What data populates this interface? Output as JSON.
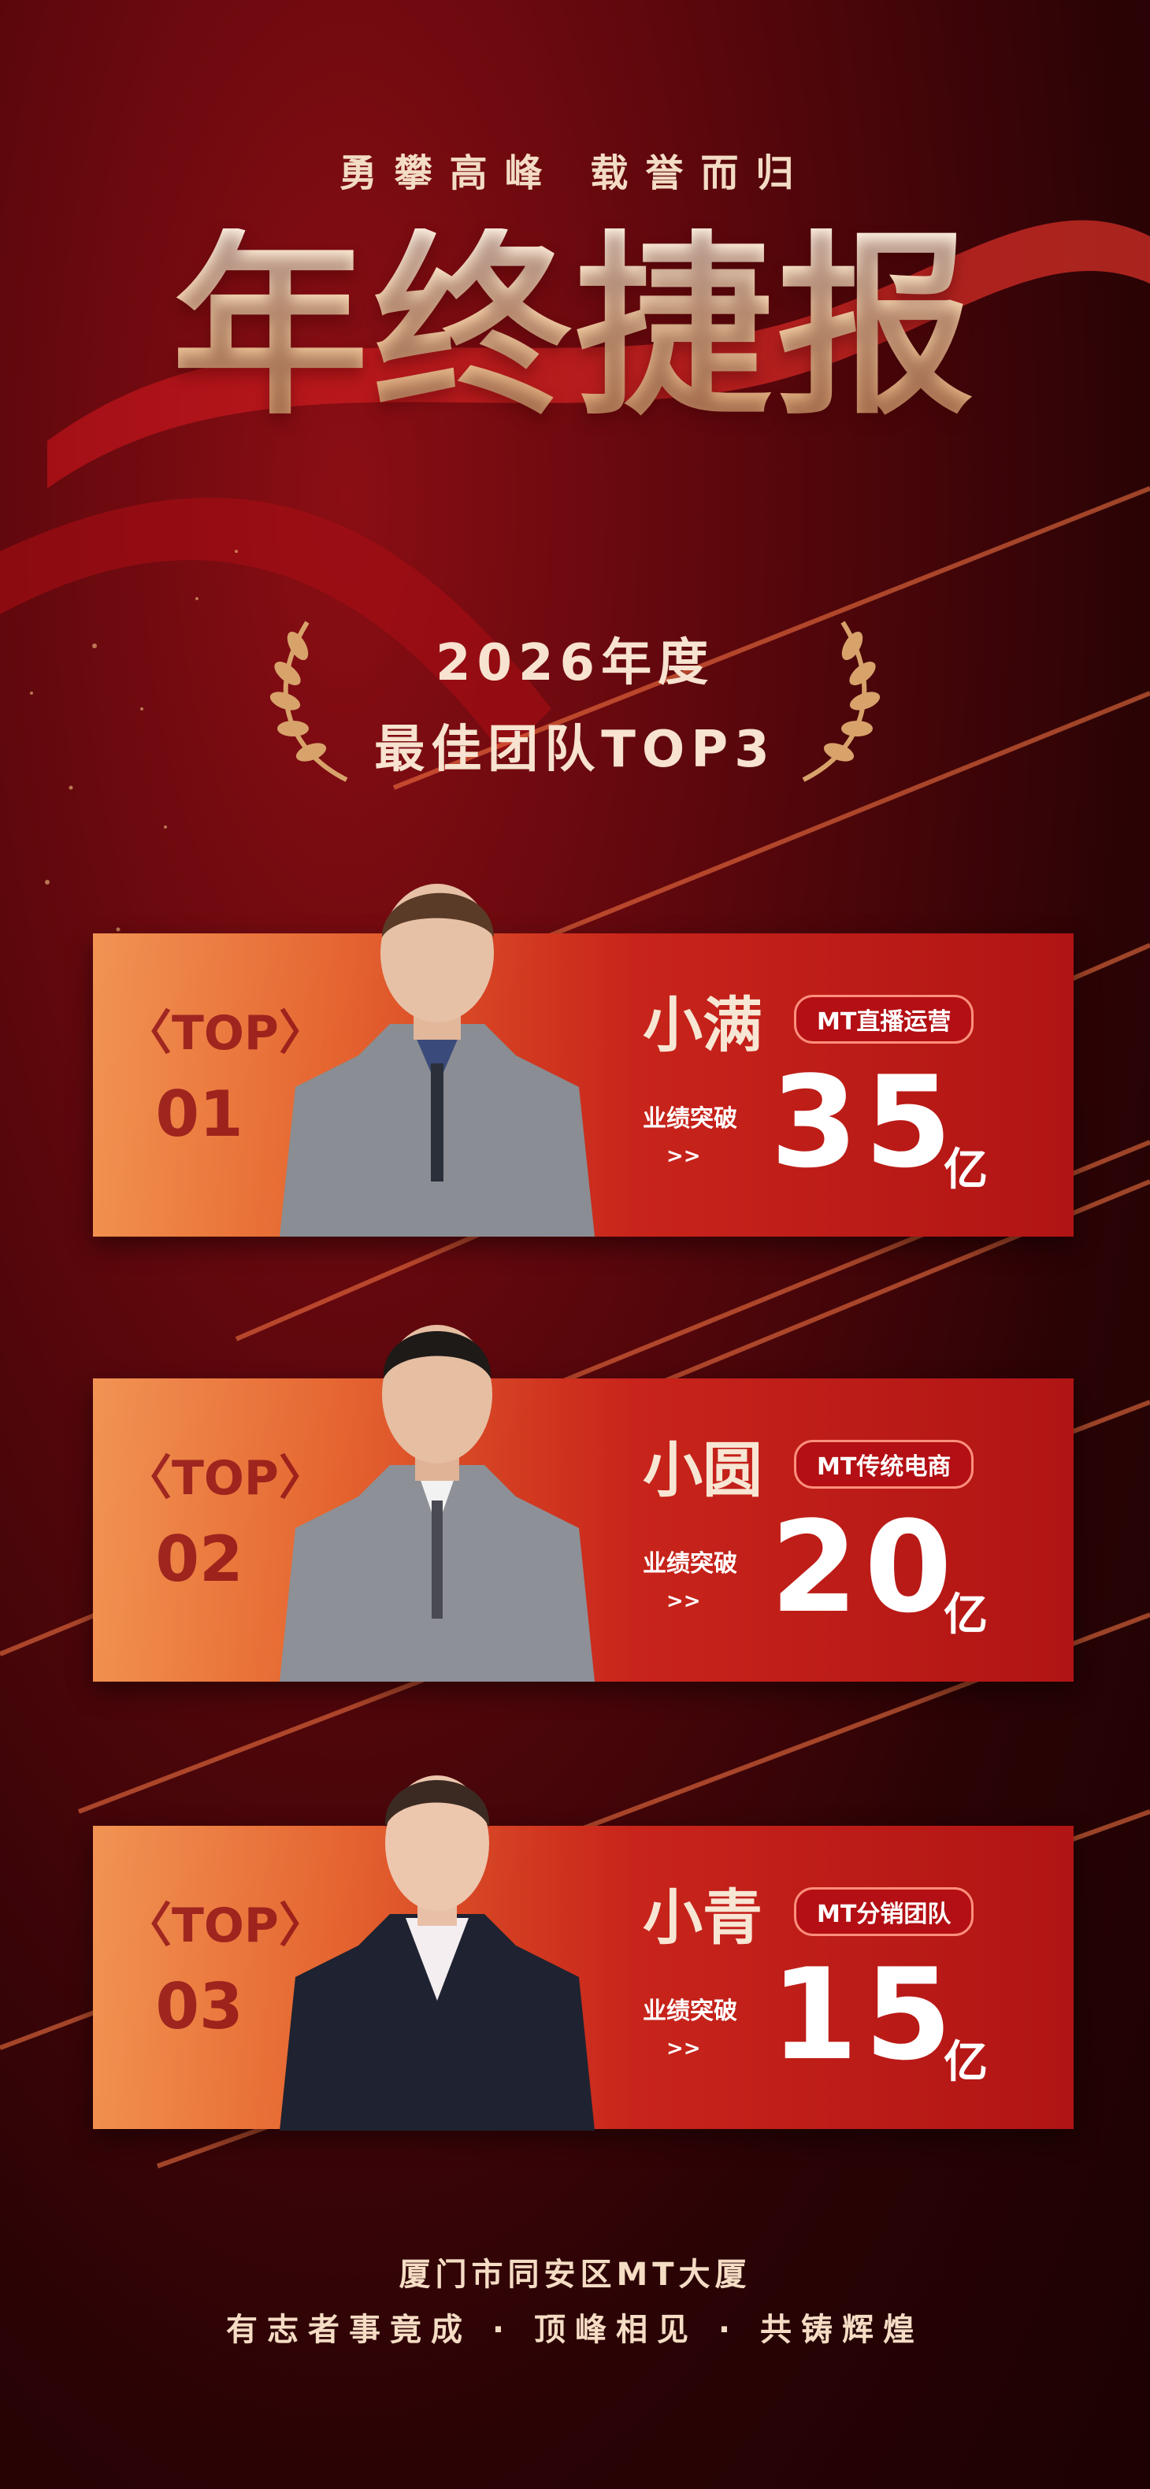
{
  "header": {
    "slogan": "勇攀高峰  载誉而归",
    "title": "年终捷报"
  },
  "award": {
    "year_line": "2026年度",
    "title_line": "最佳团队TOP3"
  },
  "cards": [
    {
      "rank_label": "〈TOP〉",
      "rank_number": "01",
      "name": "小满",
      "team": "MT直播运营",
      "perf_label": "业绩突破",
      "arrow": ">>",
      "value": "35",
      "unit": "亿"
    },
    {
      "rank_label": "〈TOP〉",
      "rank_number": "02",
      "name": "小圆",
      "team": "MT传统电商",
      "perf_label": "业绩突破",
      "arrow": ">>",
      "value": "20",
      "unit": "亿"
    },
    {
      "rank_label": "〈TOP〉",
      "rank_number": "03",
      "name": "小青",
      "team": "MT分销团队",
      "perf_label": "业绩突破",
      "arrow": ">>",
      "value": "15",
      "unit": "亿"
    }
  ],
  "footer": {
    "address": "厦门市同安区MT大厦",
    "motto": "有志者事竟成 · 顶峰相见 · 共铸辉煌"
  },
  "colors": {
    "accent_gold": "#f4cfa5",
    "card_red": "#c8241b",
    "card_orange": "#f08a45",
    "badge_red": "#b30f14"
  }
}
